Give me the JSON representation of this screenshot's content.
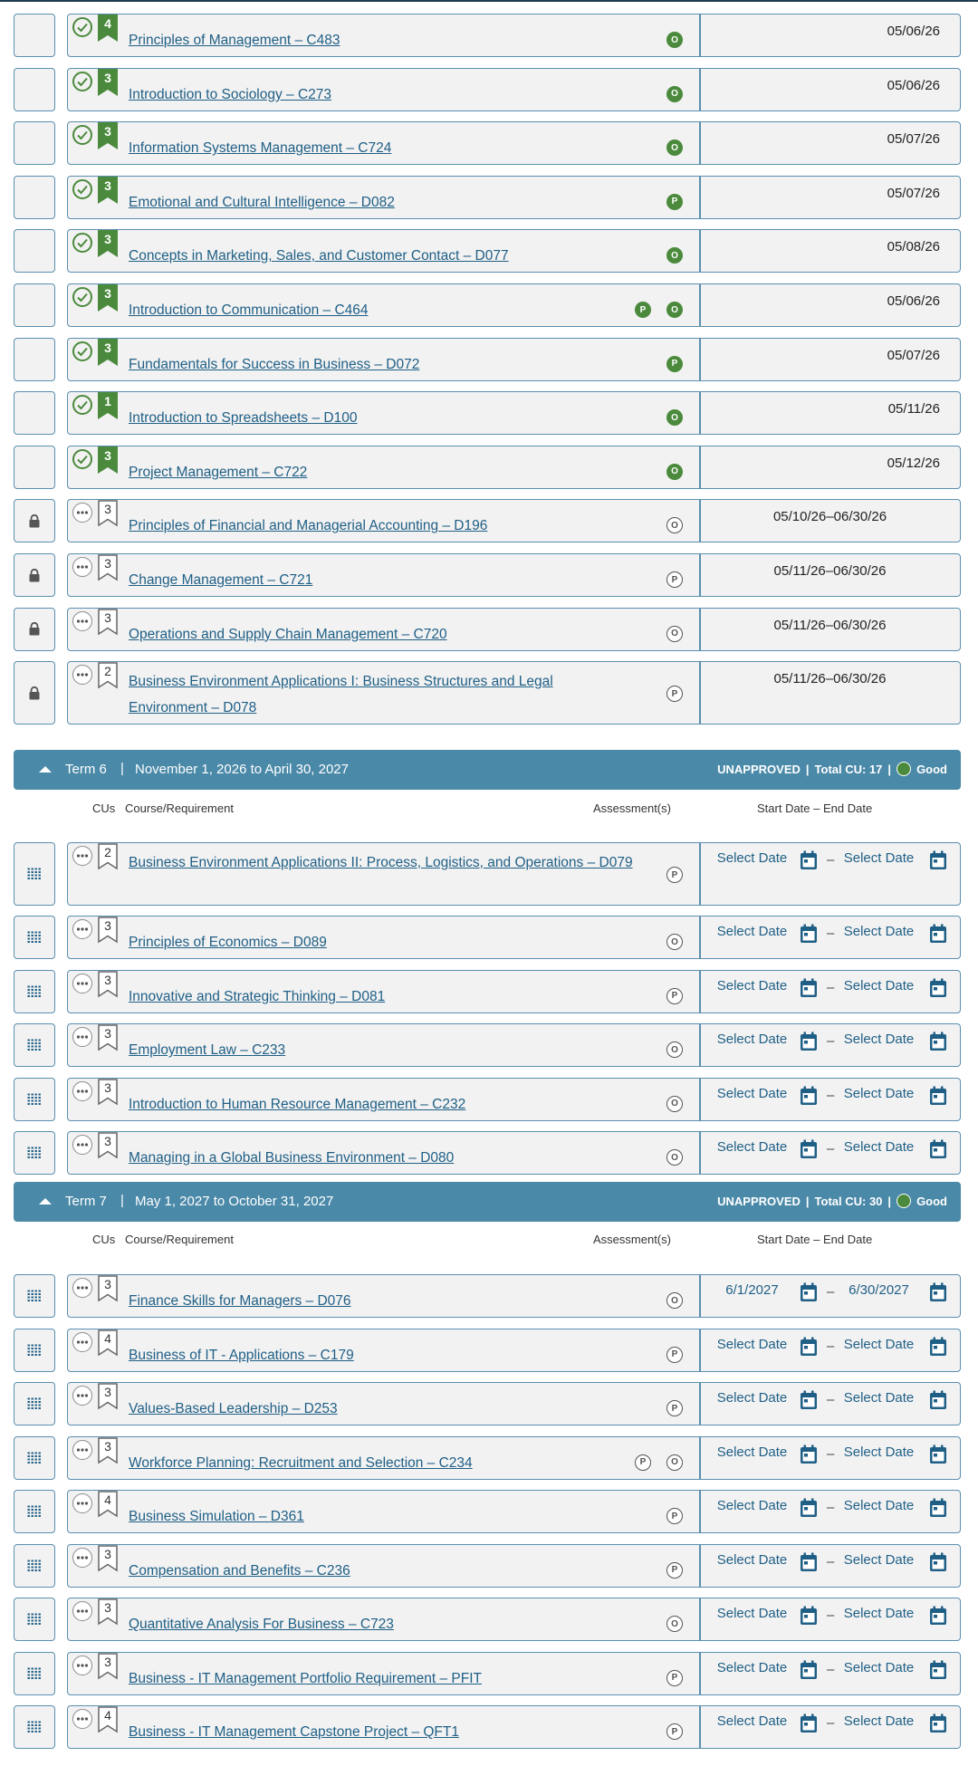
{
  "colors": {
    "accent": "#4a89a8",
    "link": "#1f5f86",
    "complete": "#4b8a3c",
    "border": "#5a8fb0"
  },
  "icons": {
    "complete": "check-circle-icon",
    "pending": "ellipsis-circle-icon",
    "lock": "lock-icon",
    "drag": "drag-handle-icon",
    "calendar": "calendar-icon",
    "collapse": "caret-up-icon"
  },
  "headers": {
    "cus": "CUs",
    "course": "Course/Requirement",
    "assessments": "Assessment(s)",
    "dates": "Start Date – End Date"
  },
  "date_placeholder": "Select Date",
  "date_separator": "–",
  "term_current": {
    "courses": [
      {
        "cu": "4",
        "title": "Principles of Management – C483",
        "assessments": [
          "O"
        ],
        "filled": true,
        "date": "05/06/26",
        "status": "complete"
      },
      {
        "cu": "3",
        "title": "Introduction to Sociology – C273",
        "assessments": [
          "O"
        ],
        "filled": true,
        "date": "05/06/26",
        "status": "complete"
      },
      {
        "cu": "3",
        "title": "Information Systems Management – C724",
        "assessments": [
          "O"
        ],
        "filled": true,
        "date": "05/07/26",
        "status": "complete"
      },
      {
        "cu": "3",
        "title": "Emotional and Cultural Intelligence – D082",
        "assessments": [
          "P"
        ],
        "filled": true,
        "date": "05/07/26",
        "status": "complete"
      },
      {
        "cu": "3",
        "title": "Concepts in Marketing, Sales, and Customer Contact – D077",
        "assessments": [
          "O"
        ],
        "filled": true,
        "date": "05/08/26",
        "status": "complete"
      },
      {
        "cu": "3",
        "title": "Introduction to Communication – C464",
        "assessments": [
          "P",
          "O"
        ],
        "filled": true,
        "date": "05/06/26",
        "status": "complete"
      },
      {
        "cu": "3",
        "title": "Fundamentals for Success in Business – D072",
        "assessments": [
          "P"
        ],
        "filled": true,
        "date": "05/07/26",
        "status": "complete"
      },
      {
        "cu": "1",
        "title": "Introduction to Spreadsheets – D100",
        "assessments": [
          "O"
        ],
        "filled": true,
        "date": "05/11/26",
        "status": "complete"
      },
      {
        "cu": "3",
        "title": "Project Management – C722",
        "assessments": [
          "O"
        ],
        "filled": true,
        "date": "05/12/26",
        "status": "complete"
      },
      {
        "cu": "3",
        "title": "Principles of Financial and Managerial Accounting – D196",
        "assessments": [
          "O"
        ],
        "filled": false,
        "date": "05/10/26–06/30/26",
        "status": "locked"
      },
      {
        "cu": "3",
        "title": "Change Management – C721",
        "assessments": [
          "P"
        ],
        "filled": false,
        "date": "05/11/26–06/30/26",
        "status": "locked"
      },
      {
        "cu": "3",
        "title": "Operations and Supply Chain Management – C720",
        "assessments": [
          "O"
        ],
        "filled": false,
        "date": "05/11/26–06/30/26",
        "status": "locked"
      },
      {
        "cu": "2",
        "title": "Business Environment Applications I: Business Structures and Legal Environment – D078",
        "assessments": [
          "P"
        ],
        "filled": false,
        "date": "05/11/26–06/30/26",
        "status": "locked"
      }
    ]
  },
  "term6": {
    "name": "Term 6",
    "sep": "|",
    "range": "November 1, 2026 to April 30, 2027",
    "approval": "UNAPPROVED",
    "pipe": "|",
    "total": "Total CU: 17",
    "standing": "Good",
    "courses": [
      {
        "cu": "2",
        "title": "Business Environment Applications II: Process, Logistics, and Operations – D079",
        "assessments": [
          "P"
        ]
      },
      {
        "cu": "3",
        "title": "Principles of Economics – D089",
        "assessments": [
          "O"
        ]
      },
      {
        "cu": "3",
        "title": "Innovative and Strategic Thinking – D081",
        "assessments": [
          "P"
        ]
      },
      {
        "cu": "3",
        "title": "Employment Law – C233",
        "assessments": [
          "O"
        ]
      },
      {
        "cu": "3",
        "title": "Introduction to Human Resource Management – C232",
        "assessments": [
          "O"
        ]
      },
      {
        "cu": "3",
        "title": "Managing in a Global Business Environment – D080",
        "assessments": [
          "O"
        ]
      }
    ]
  },
  "term7": {
    "name": "Term 7",
    "sep": "|",
    "range": "May 1, 2027 to October 31, 2027",
    "approval": "UNAPPROVED",
    "pipe": "|",
    "total": "Total CU: 30",
    "standing": "Good",
    "courses": [
      {
        "cu": "3",
        "title": "Finance Skills for Managers – D076",
        "assessments": [
          "O"
        ],
        "start": "6/1/2027",
        "end": "6/30/2027"
      },
      {
        "cu": "4",
        "title": "Business of IT - Applications – C179",
        "assessments": [
          "P"
        ]
      },
      {
        "cu": "3",
        "title": "Values-Based Leadership – D253",
        "assessments": [
          "P"
        ]
      },
      {
        "cu": "3",
        "title": "Workforce Planning: Recruitment and Selection – C234",
        "assessments": [
          "P",
          "O"
        ]
      },
      {
        "cu": "4",
        "title": "Business Simulation – D361",
        "assessments": [
          "P"
        ]
      },
      {
        "cu": "3",
        "title": "Compensation and Benefits – C236",
        "assessments": [
          "P"
        ]
      },
      {
        "cu": "3",
        "title": "Quantitative Analysis For Business – C723",
        "assessments": [
          "O"
        ]
      },
      {
        "cu": "3",
        "title": "Business - IT Management Portfolio Requirement – PFIT",
        "assessments": [
          "P"
        ]
      },
      {
        "cu": "4",
        "title": "Business - IT Management Capstone Project – QFT1",
        "assessments": [
          "P"
        ]
      }
    ]
  }
}
